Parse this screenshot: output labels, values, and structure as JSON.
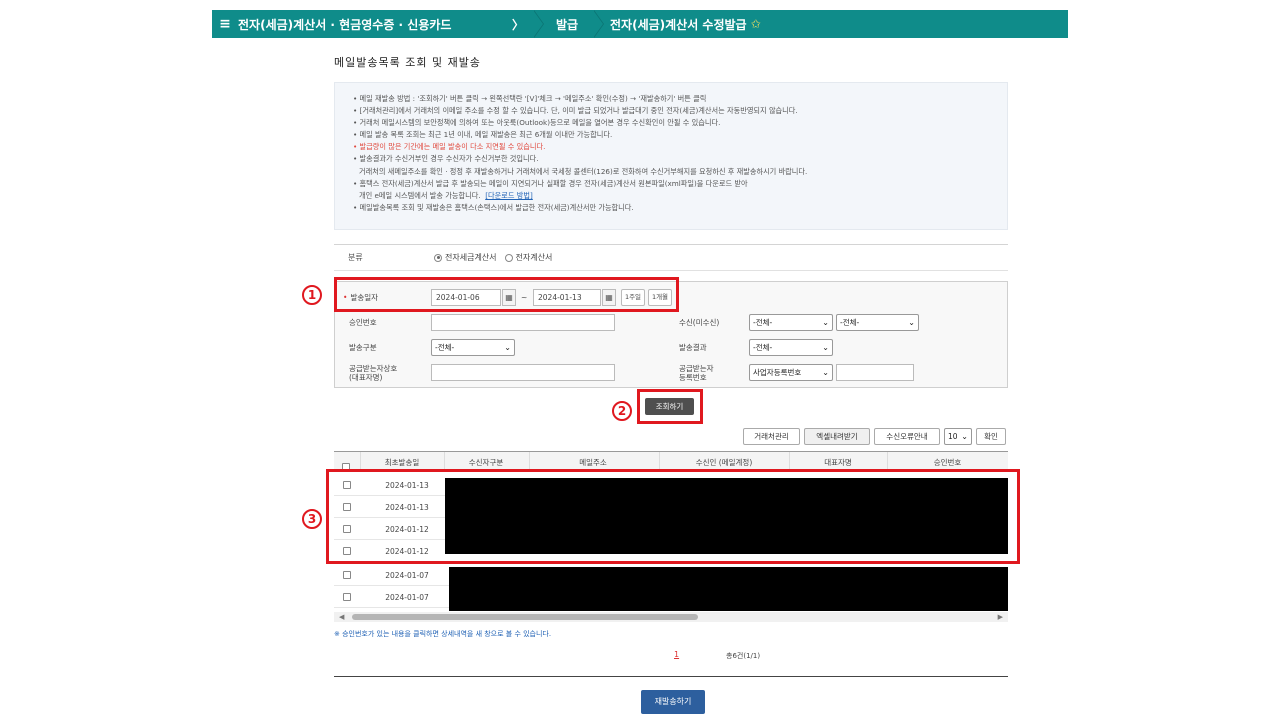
{
  "nav": {
    "menu_icon": "menu-icon",
    "crumb1": "전자(세금)계산서 · 현금영수증 · 신용카드",
    "crumb2": "발급",
    "crumb3": "전자(세금)계산서 수정발급"
  },
  "page_title": "메일발송목록 조회 및 재발송",
  "notice": [
    {
      "text": "• 메일 재발송 방법 : '조회하기' 버튼 클릭 → 왼쪽선택란 '[V]'체크 → '메일주소' 확인(수정) → '재발송하기' 버튼 클릭",
      "style": ""
    },
    {
      "text": "• [거래처관리]에서 거래처의 이메일 주소를 수정 할 수 있습니다. 단, 이미 발급 되었거나 발급대기 중인 전자(세금)계산서는 자동반영되지 않습니다.",
      "style": ""
    },
    {
      "text": "• 거래처 메일시스템의 보안정책에 의하여 또는 아웃룩(Outlook)등으로 메일을 열어본 경우 수신확인이 안될 수 있습니다.",
      "style": ""
    },
    {
      "text": "• 메일 발송 목록 조회는 최근 1년 이내, 메일 재발송은 최근 6개월 이내만 가능합니다.",
      "style": ""
    },
    {
      "text": "• 발급량이 많은 기간에는 메일 발송이 다소 지연될 수 있습니다.",
      "style": "red"
    },
    {
      "text": "• 발송결과가 수신거부인 경우 수신자가 수신거부한 것입니다.",
      "style": ""
    },
    {
      "text": "거래처의 새메일주소를 확인 · 정정 후 재발송하거나 거래처에서 국세청 콜센터(126)로 전화하여 수신거부해지를 요청하신 후 재발송하시기 바랍니다.",
      "style": "indent"
    },
    {
      "text": "• 홈택스 전자(세금)계산서 발급 후 발송되는 메일이 지연되거나 실패할 경우 전자(세금)계산서 원본파일(xml파일)을 다운로드 받아",
      "style": ""
    },
    {
      "text": "개인 e메일 시스템에서 발송 가능합니다.",
      "style": "indent",
      "link": "[다운로드 방법]"
    },
    {
      "text": "• 메일발송목록 조회 및 재발송은 홈택스(손택스)에서 발급한 전자(세금)계산서만 가능합니다.",
      "style": ""
    }
  ],
  "category": {
    "label": "분류",
    "options": [
      "전자세금계산서",
      "전자계산서"
    ],
    "selected": 0
  },
  "search": {
    "date_label": "발송일자",
    "date_from": "2024-01-06",
    "date_to": "2024-01-13",
    "tilde": "~",
    "btn_1week": "1주일",
    "btn_1month": "1개월",
    "approval_no_label": "승인번호",
    "receiver_label": "수신(미수신)",
    "receiver_sel1": "-전체-",
    "receiver_sel2": "-전체-",
    "send_type_label": "발송구분",
    "send_type_value": "-전체-",
    "send_result_label": "발송결과",
    "send_result_value": "-전체-",
    "supplier_name_label1": "공급받는자상호",
    "supplier_name_label2": "(대표자명)",
    "supplier_reg_label1": "공급받는자",
    "supplier_reg_label2": "등록번호",
    "supplier_reg_type": "사업자등록번호"
  },
  "search_button": "조회하기",
  "toolbar": {
    "client_mgmt": "거래처관리",
    "excel_download": "엑셀내려받기",
    "reject_guide": "수신오류안내",
    "page_size": "10",
    "confirm": "확인"
  },
  "table": {
    "headers": [
      "최초발송일",
      "수신자구분",
      "메일주소",
      "수신인 (메일계정)",
      "대표자명",
      "승인번호"
    ],
    "rows": [
      {
        "date": "2024-01-13"
      },
      {
        "date": "2024-01-13"
      },
      {
        "date": "2024-01-12"
      },
      {
        "date": "2024-01-12"
      },
      {
        "date": "2024-01-07"
      },
      {
        "date": "2024-01-07"
      }
    ]
  },
  "footnote": "※ 승인번호가 있는 내용을 클릭하면 상세내역을 새 창으로 볼 수 있습니다.",
  "pagination": {
    "current": "1",
    "total": "총6건(1/1)"
  },
  "resend_button": "재발송하기",
  "annotations": {
    "n1": "1",
    "n2": "2",
    "n3": "3"
  },
  "colors": {
    "nav": "#0f8c8a",
    "highlight": "#e0181f",
    "primary_button": "#2d5f9e"
  }
}
